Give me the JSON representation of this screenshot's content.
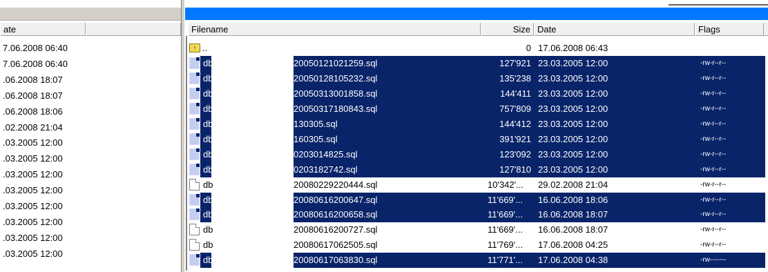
{
  "left_pane": {
    "header": {
      "date_label": "ate"
    },
    "dates": [
      "7.06.2008 06:40",
      "7.06.2008 06:40",
      ".06.2008 18:07",
      ".06.2008 18:07",
      ".06.2008 18:06",
      ".02.2008 21:04",
      ".03.2005 12:00",
      ".03.2005 12:00",
      ".03.2005 12:00",
      ".03.2005 12:00",
      ".03.2005 12:00",
      ".03.2005 12:00",
      ".03.2005 12:00",
      ".03.2005 12:00"
    ]
  },
  "right_pane": {
    "header": {
      "filename": "Filename",
      "size": "Size",
      "date": "Date",
      "flags": "Flags"
    },
    "parent_row": {
      "name": "..",
      "size": "0",
      "date": "17.06.2008 06:43"
    },
    "files": [
      {
        "prefix": "db",
        "name": "20050121021259.sql",
        "size": "127'921",
        "date": "23.03.2005 12:00",
        "flags": "-rw-r--r--",
        "selected": true
      },
      {
        "prefix": "db",
        "name": "20050128105232.sql",
        "size": "135'238",
        "date": "23.03.2005 12:00",
        "flags": "-rw-r--r--",
        "selected": true
      },
      {
        "prefix": "db",
        "name": "20050313001858.sql",
        "size": "144'411",
        "date": "23.03.2005 12:00",
        "flags": "-rw-r--r--",
        "selected": true
      },
      {
        "prefix": "db",
        "name": "20050317180843.sql",
        "size": "757'809",
        "date": "23.03.2005 12:00",
        "flags": "-rw-r--r--",
        "selected": true
      },
      {
        "prefix": "db",
        "name": "130305.sql",
        "size": "144'412",
        "date": "23.03.2005 12:00",
        "flags": "-rw-r--r--",
        "selected": true
      },
      {
        "prefix": "db",
        "name": "160305.sql",
        "size": "391'921",
        "date": "23.03.2005 12:00",
        "flags": "-rw-r--r--",
        "selected": true
      },
      {
        "prefix": "db",
        "name": "0203014825.sql",
        "size": "123'092",
        "date": "23.03.2005 12:00",
        "flags": "-rw-r--r--",
        "selected": true
      },
      {
        "prefix": "db",
        "name": "0203182742.sql",
        "size": "127'810",
        "date": "23.03.2005 12:00",
        "flags": "-rw-r--r--",
        "selected": true
      },
      {
        "prefix": "db",
        "name": "20080229220444.sql",
        "size": "10'342'...",
        "date": "29.02.2008 21:04",
        "flags": "-rw-r--r--",
        "selected": false
      },
      {
        "prefix": "db",
        "name": "20080616200647.sql",
        "size": "11'669'...",
        "date": "16.06.2008 18:06",
        "flags": "-rw-r--r--",
        "selected": true
      },
      {
        "prefix": "db",
        "name": "20080616200658.sql",
        "size": "11'669'...",
        "date": "16.06.2008 18:07",
        "flags": "-rw-r--r--",
        "selected": true
      },
      {
        "prefix": "db",
        "name": "20080616200727.sql",
        "size": "11'669'...",
        "date": "16.06.2008 18:07",
        "flags": "-rw-r--r--",
        "selected": false
      },
      {
        "prefix": "db",
        "name": "20080617062505.sql",
        "size": "11'769'...",
        "date": "17.06.2008 04:25",
        "flags": "-rw-r--r--",
        "selected": false
      },
      {
        "prefix": "db",
        "name": "20080617063830.sql",
        "size": "11'771'...",
        "date": "17.06.2008 04:38",
        "flags": "-rw-------",
        "selected": true
      }
    ]
  },
  "colors": {
    "selection": "#0a246a",
    "active_title": "#0078ff",
    "inactive_title": "#d4d0c8"
  }
}
